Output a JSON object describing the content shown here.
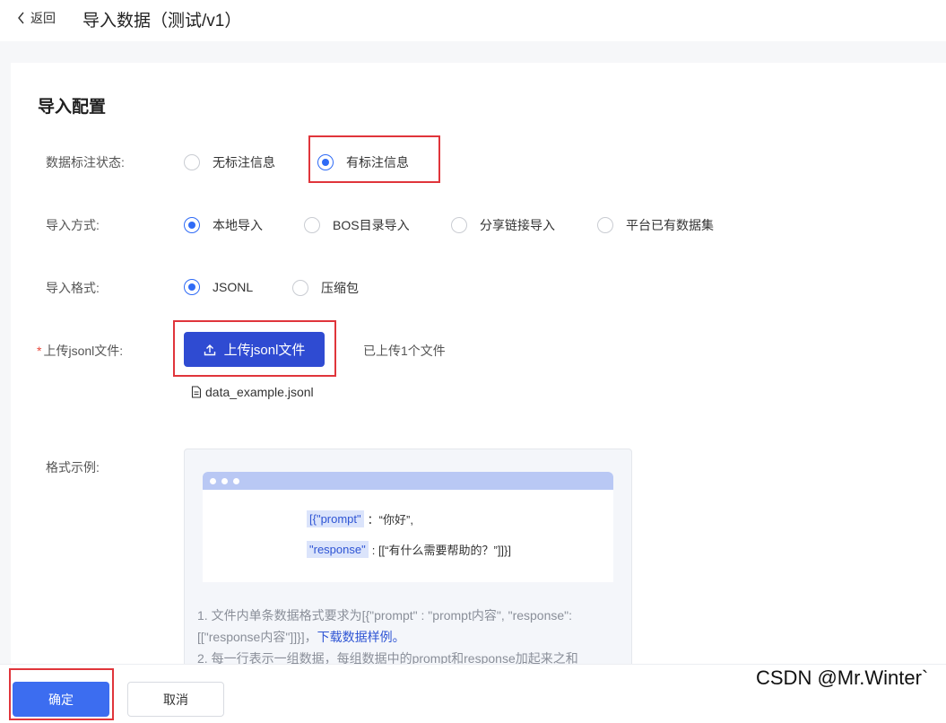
{
  "header": {
    "back_label": "返回",
    "title": "导入数据（测试/v1）"
  },
  "section": {
    "title": "导入配置"
  },
  "annotation_status": {
    "label": "数据标注状态:",
    "options": [
      "无标注信息",
      "有标注信息"
    ],
    "selected": "有标注信息"
  },
  "import_method": {
    "label": "导入方式:",
    "options": [
      "本地导入",
      "BOS目录导入",
      "分享链接导入",
      "平台已有数据集"
    ],
    "selected": "本地导入"
  },
  "import_format": {
    "label": "导入格式:",
    "options": [
      "JSONL",
      "压缩包"
    ],
    "selected": "JSONL"
  },
  "upload": {
    "required_mark": "*",
    "label": "上传jsonl文件:",
    "button_label": "上传jsonl文件",
    "status": "已上传1个文件",
    "file_name": "data_example.jsonl"
  },
  "format_example": {
    "label": "格式示例:",
    "code_key1": "[{\"prompt\"",
    "code_rest1": "：“你好”,",
    "code_key2": "\"response\"",
    "code_rest2": ": [[“有什么需要帮助的？”]]}]",
    "desc1_prefix": "1. 文件内单条数据格式要求为[{\"prompt\" : \"prompt内容\", \"response\": [[\"response内容\"]]}]，",
    "desc1_link": "下载数据样例。",
    "desc2": "2. 每一行表示一组数据，每组数据中的prompt和response加起来之和"
  },
  "footer": {
    "confirm_label": "确定",
    "cancel_label": "取消"
  },
  "watermark": "CSDN @Mr.Winter`",
  "colors": {
    "primary": "#2f6bf6",
    "upload_button": "#2f4bd2",
    "confirm_button": "#3c6df0",
    "highlight_box": "#e0353b"
  }
}
